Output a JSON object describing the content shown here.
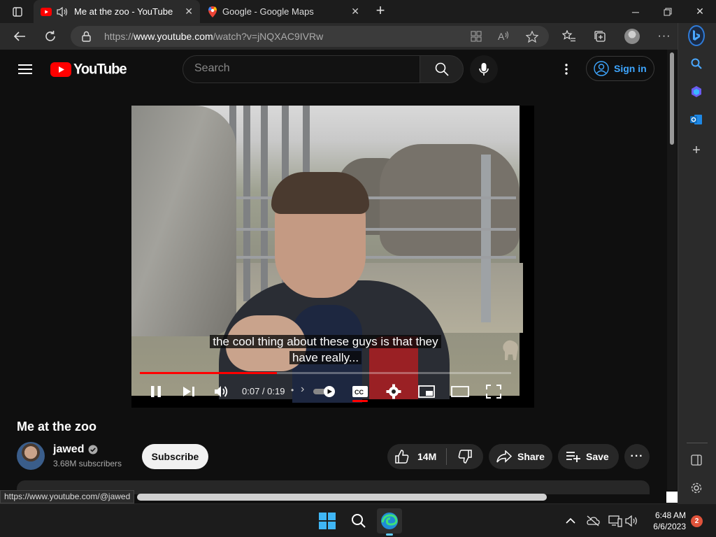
{
  "browser": {
    "tabs": [
      {
        "title": "Me at the zoo - YouTube",
        "active": true,
        "audio": true
      },
      {
        "title": "Google - Google Maps",
        "active": false
      }
    ],
    "url_prefix": "https://",
    "url_domain": "www.youtube.com",
    "url_path": "/watch?v=jNQXAC9IVRw",
    "status_link": "https://www.youtube.com/@jawed"
  },
  "youtube": {
    "logo_text": "YouTube",
    "search_placeholder": "Search",
    "sign_in": "Sign in",
    "video": {
      "title": "Me at the zoo",
      "caption_line1": "the cool thing about these guys is that they",
      "caption_line2": "have really...",
      "time": "0:07 / 0:19",
      "progress_fraction": 0.37,
      "cc_on": true
    },
    "channel": {
      "name": "jawed",
      "subscribers": "3.68M subscribers",
      "verified": true
    },
    "actions": {
      "subscribe": "Subscribe",
      "likes": "14M",
      "share": "Share",
      "save": "Save"
    }
  },
  "taskbar": {
    "time": "6:48 AM",
    "date": "6/6/2023",
    "notifications": "2"
  },
  "colors": {
    "accent_red": "#ff0000",
    "link_blue": "#3ea6ff",
    "background": "#0f0f0f"
  }
}
